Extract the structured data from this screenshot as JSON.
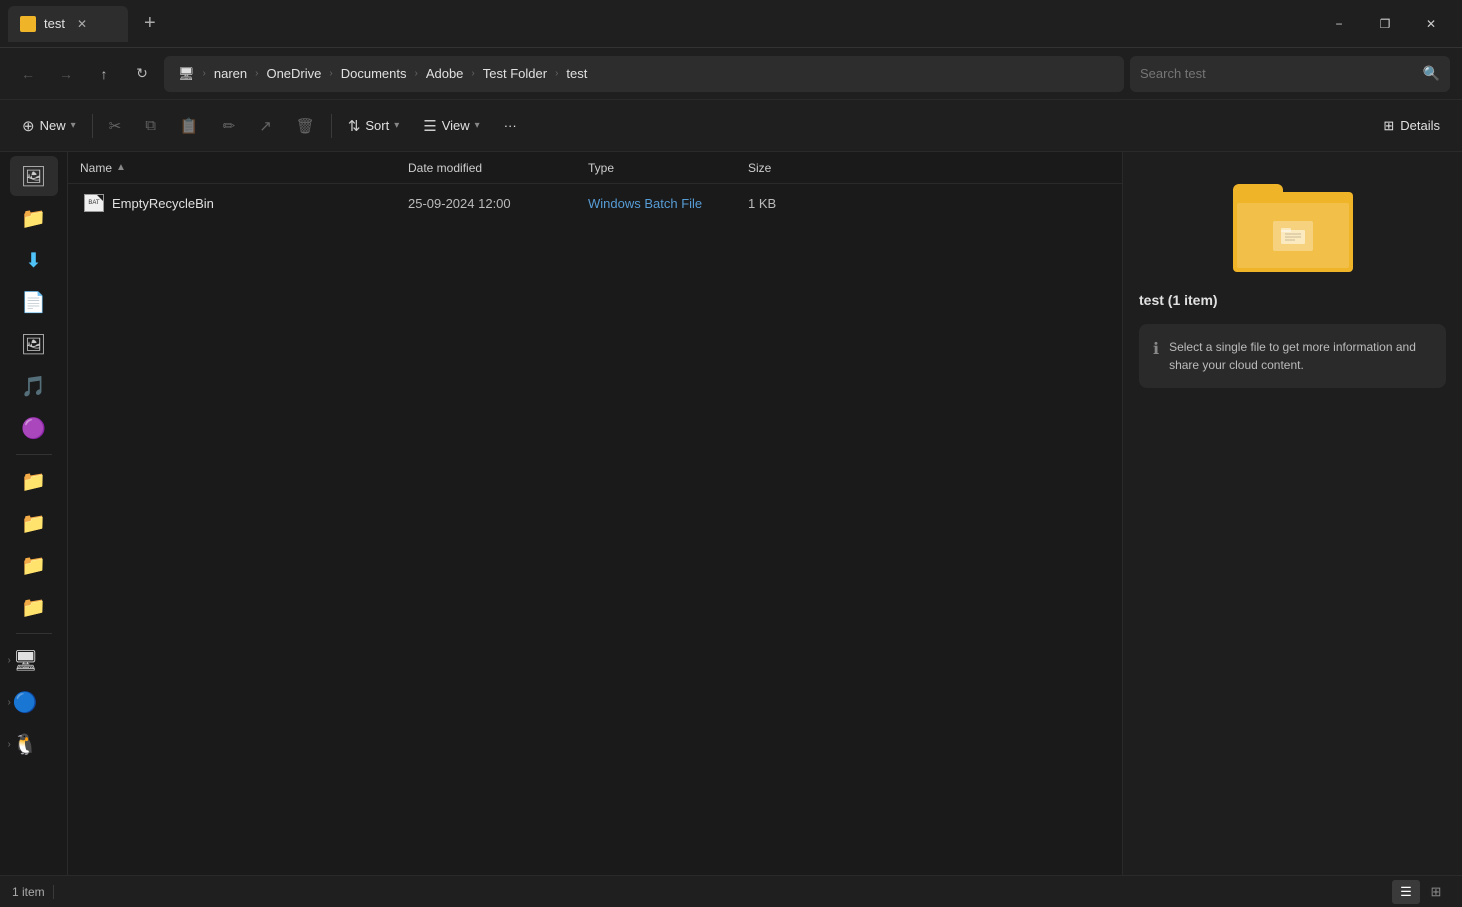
{
  "titleBar": {
    "tab": {
      "title": "test",
      "icon": "folder-icon"
    },
    "newTabBtn": "+",
    "controls": {
      "minimize": "−",
      "restore": "❐",
      "close": "✕"
    }
  },
  "addressBar": {
    "navBack": "←",
    "navForward": "→",
    "navUp": "↑",
    "navRefresh": "↻",
    "breadcrumb": [
      {
        "label": "🖥",
        "type": "icon"
      },
      {
        "label": "naren"
      },
      {
        "label": "OneDrive"
      },
      {
        "label": "Documents"
      },
      {
        "label": "Adobe"
      },
      {
        "label": "Test Folder"
      },
      {
        "label": "test"
      }
    ],
    "search": {
      "placeholder": "Search test",
      "value": ""
    }
  },
  "toolbar": {
    "new_label": "New",
    "cut_label": "",
    "copy_label": "",
    "paste_label": "",
    "rename_label": "",
    "share_label": "",
    "delete_label": "",
    "sort_label": "Sort",
    "view_label": "View",
    "more_label": "···",
    "details_label": "Details"
  },
  "columns": {
    "name": "Name",
    "dateModified": "Date modified",
    "type": "Type",
    "size": "Size"
  },
  "files": [
    {
      "name": "EmptyRecycleBin",
      "dateModified": "25-09-2024 12:00",
      "type": "Windows Batch File",
      "size": "1 KB",
      "icon": "batch-file"
    }
  ],
  "sidebar": {
    "items": [
      {
        "icon": "🖼",
        "label": "gallery",
        "active": true
      },
      {
        "icon": "📁",
        "label": "folders"
      },
      {
        "icon": "⬇",
        "label": "downloads"
      },
      {
        "icon": "📄",
        "label": "documents"
      },
      {
        "icon": "🖼",
        "label": "pictures"
      },
      {
        "icon": "🎵",
        "label": "music"
      },
      {
        "icon": "🟣",
        "label": "app1"
      },
      {
        "icon": "📁",
        "label": "folder1"
      },
      {
        "icon": "📁",
        "label": "folder2"
      },
      {
        "icon": "📁",
        "label": "folder3"
      }
    ],
    "groups": [
      {
        "icon": "🖥",
        "label": "this-pc",
        "expanded": false
      },
      {
        "icon": "🐦",
        "label": "network",
        "expanded": false
      },
      {
        "icon": "🐧",
        "label": "linux",
        "expanded": false
      }
    ]
  },
  "detailsPanel": {
    "folderName": "test (1 item)",
    "infoText": "Select a single file to get more information and share your cloud content."
  },
  "statusBar": {
    "itemCount": "1 item",
    "viewList": "☰",
    "viewDetails": "⊞"
  }
}
